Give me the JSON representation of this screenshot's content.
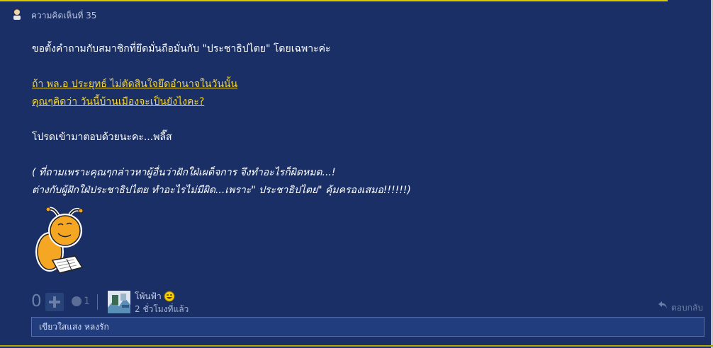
{
  "header": {
    "comment_number": "ความคิดเห็นที่ 35"
  },
  "body": {
    "line1": "ขอตั้งคำถามกับสมาชิกที่ยึดมั่นถือมั่นกับ \"ประชาธิปไตย\" โดยเฉพาะค่ะ",
    "link1": "ถ้า พล.อ ประยุทธ์ ไม่ตัดสินใจยึดอำนาจในวันนั้น",
    "link2": "คุณๆคิดว่า วันนี้บ้านเมืองจะเป็นยังไงคะ?",
    "line2": "โปรดเข้ามาตอบด้วยนะคะ...พลี๊ส",
    "italic1": "( ที่ถามเพราะคุณๆกล่าวหาผู้อื่นว่าฝักใฝ่เผด็จการ จึงทำอะไรก็ผิดหมด...!",
    "italic2": "ต่างกับผู้ฝักใฝ่ประชาธิปไตย ทำอะไรไม่มีผิด...เพราะ\" ประชาธิปไตย\" คุ้มครองเสมอ!!!!!!)"
  },
  "footer": {
    "vote_count": "0",
    "emotion_count": "1",
    "author": "โพ้นฟ้า",
    "time": "2 ชั่วโมงที่แล้ว",
    "reply_label": "ตอบกลับ",
    "reply_value": "เขียวใสแสง หลงรัก"
  },
  "icons": [
    "user-icon",
    "mascot-reading-icon",
    "plus-icon",
    "emotion-icon",
    "avatar",
    "laughing-emoji-icon",
    "reply-arrow-icon"
  ],
  "colors": {
    "background": "#1a2f66",
    "link": "#f3d63c",
    "accent_line": "#d9c900"
  }
}
